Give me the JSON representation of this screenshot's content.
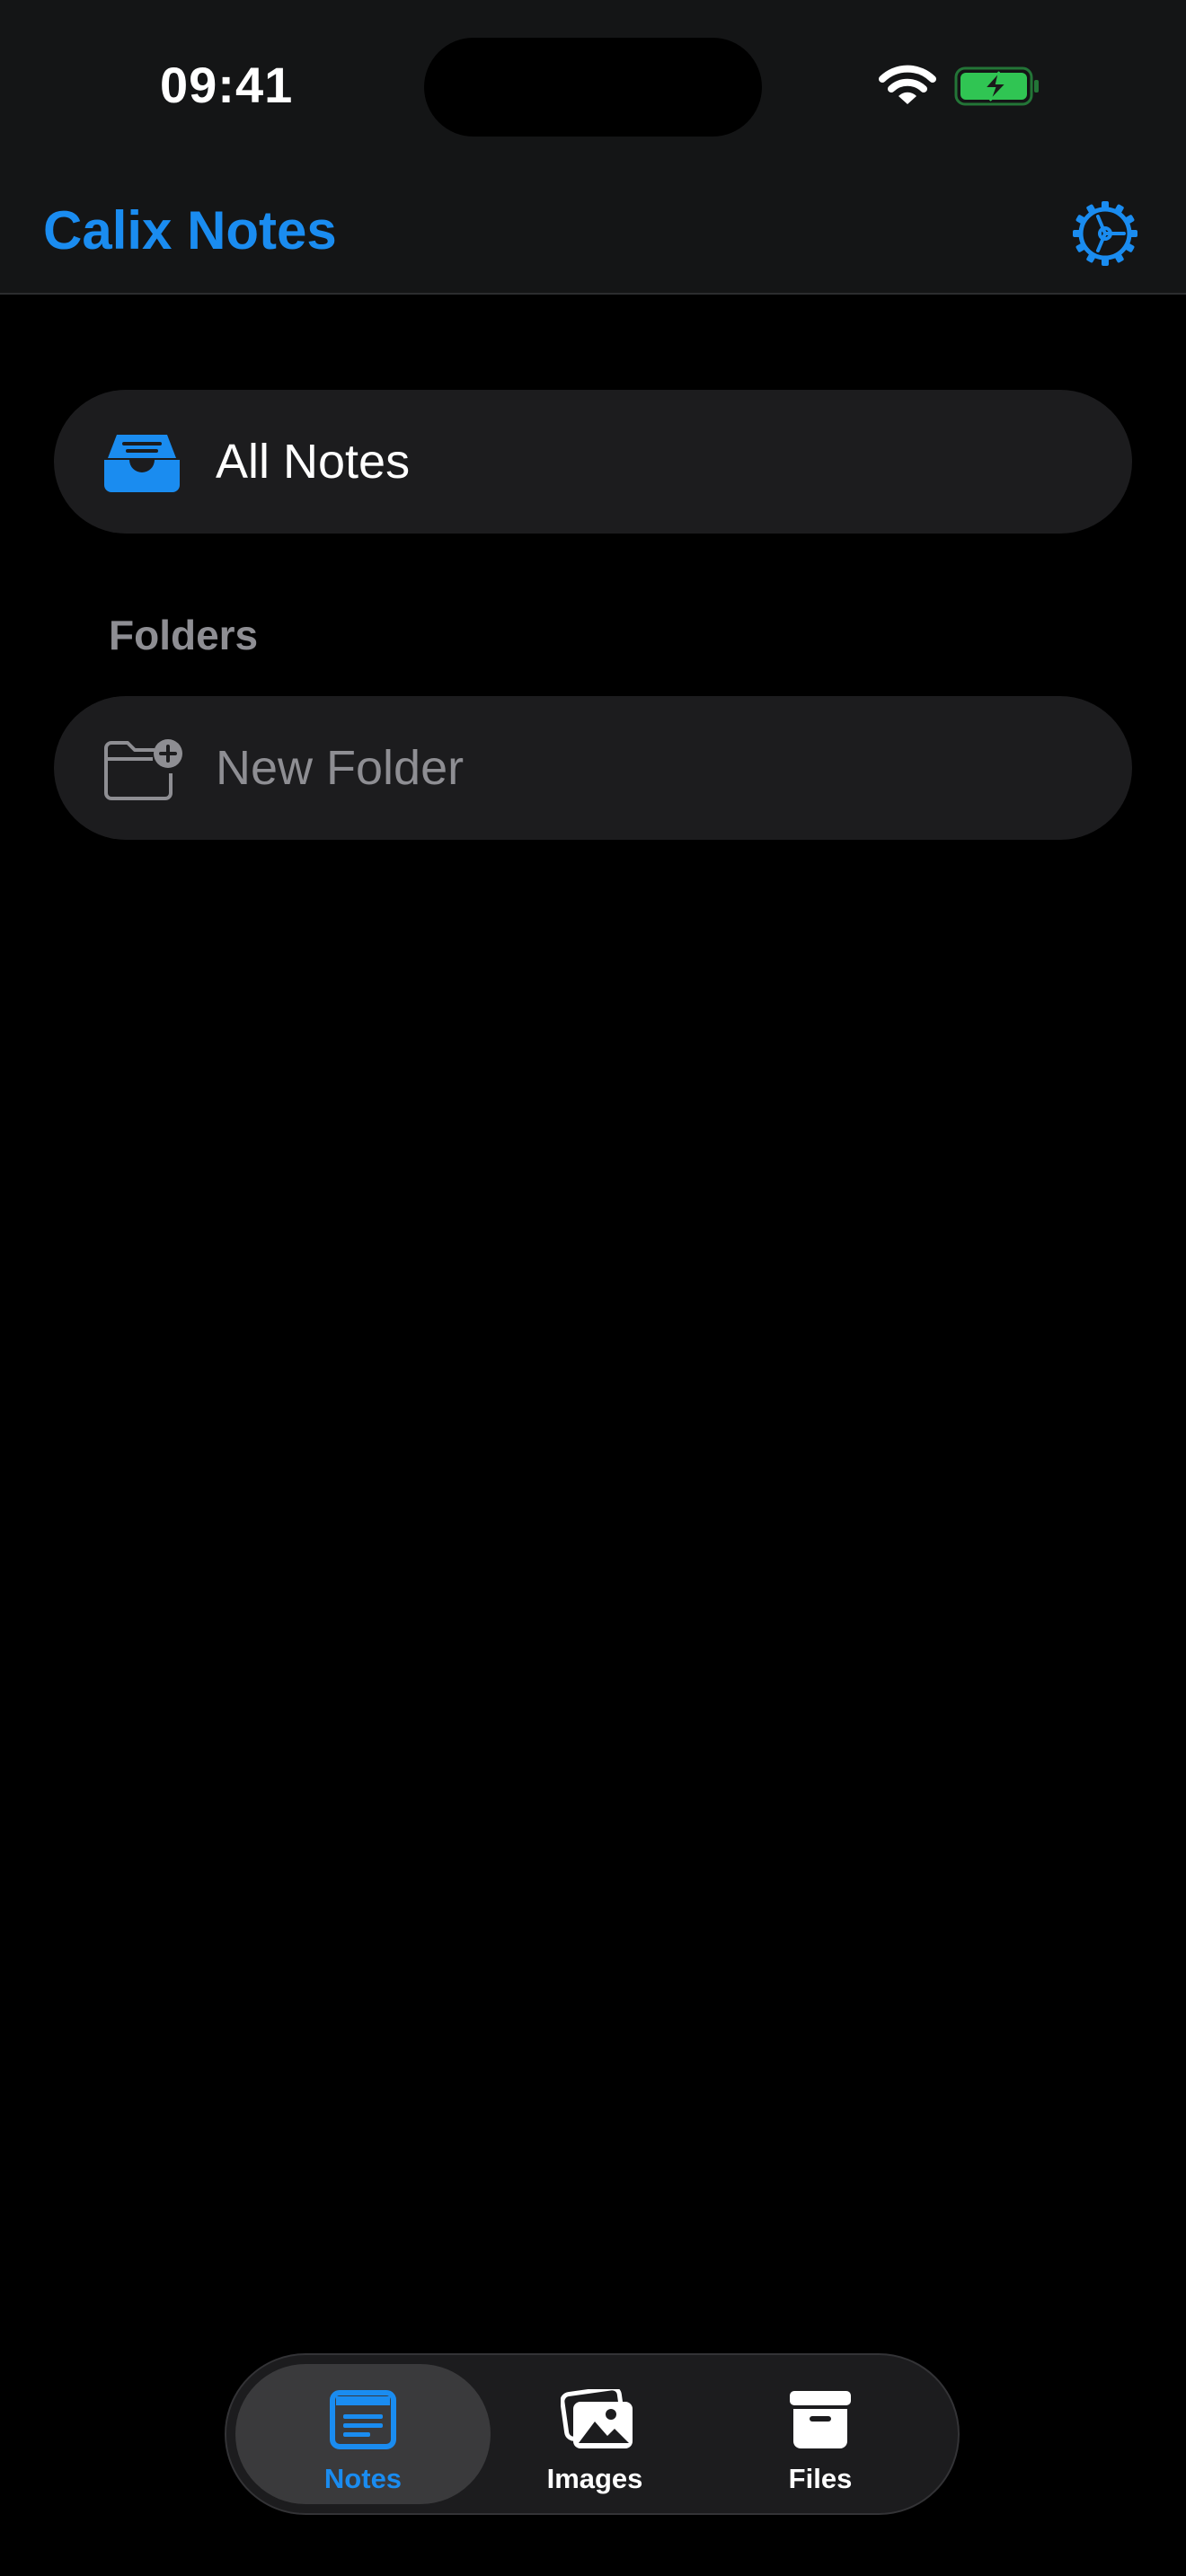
{
  "status_bar": {
    "time": "09:41"
  },
  "header": {
    "title": "Calix Notes",
    "settings_icon": "gear-icon"
  },
  "all_notes": {
    "label": "All Notes",
    "icon": "tray-icon"
  },
  "folders": {
    "section_title": "Folders",
    "new_folder_label": "New Folder",
    "new_folder_icon": "folder-badge-plus-icon"
  },
  "tab_bar": {
    "tabs": [
      {
        "label": "Notes",
        "icon": "note-text-icon",
        "selected": true
      },
      {
        "label": "Images",
        "icon": "photos-icon",
        "selected": false
      },
      {
        "label": "Files",
        "icon": "archive-box-icon",
        "selected": false
      }
    ]
  },
  "colors": {
    "accent": "#1a8cf0",
    "background": "#000000",
    "header_bg": "#141516",
    "row_bg": "#1c1c1e",
    "secondary_text": "#8e8e93",
    "battery_green": "#30c553"
  }
}
